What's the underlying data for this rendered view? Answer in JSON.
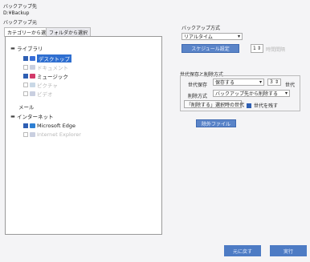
{
  "backup_dest": {
    "label": "バックアップ先",
    "path": "D:¥Backup"
  },
  "source": {
    "label": "バックアップ元",
    "tabs": [
      {
        "label": "カテゴリーから選択",
        "active": true
      },
      {
        "label": "フォルダから選択",
        "active": false
      }
    ]
  },
  "tree": {
    "library": {
      "label": "ライブラリ",
      "items": [
        {
          "label": "デスクトップ",
          "state": "selected",
          "color": "#3a6fd8"
        },
        {
          "label": "ドキュメント",
          "state": "disabled",
          "color": "#c9cfe0"
        },
        {
          "label": "ミュージック",
          "state": "enabled",
          "color": "#d23a6a"
        },
        {
          "label": "ピクチャ",
          "state": "disabled",
          "color": "#c9d8e6"
        },
        {
          "label": "ビデオ",
          "state": "disabled",
          "color": "#c9cfe0"
        }
      ]
    },
    "mail": {
      "label": "メール"
    },
    "internet": {
      "label": "インターネット",
      "items": [
        {
          "label": "Microsoft Edge",
          "state": "enabled",
          "color": "#2d7fd3"
        },
        {
          "label": "Internet Explorer",
          "state": "disabled",
          "color": "#c9cfe0"
        }
      ]
    }
  },
  "method": {
    "label": "バックアップ方式",
    "mode": "リアルタイム",
    "schedule_button": "スケジュール設定",
    "interval_value": "1",
    "interval_unit": "時間間隔"
  },
  "generation": {
    "title": "世代保存と削除方式",
    "gen_label": "世代保存",
    "gen_value": "保存する",
    "gen_count": "3",
    "gen_unit": "世代",
    "delete_label": "削除方式",
    "delete_value": "バックアップ先から削除する",
    "restore_label": "「削除する」選択時の世代",
    "keep_label": "世代を残す"
  },
  "exclude_button": "除外ファイル",
  "footer": {
    "back_button": "元に戻す",
    "run_button": "実行"
  }
}
